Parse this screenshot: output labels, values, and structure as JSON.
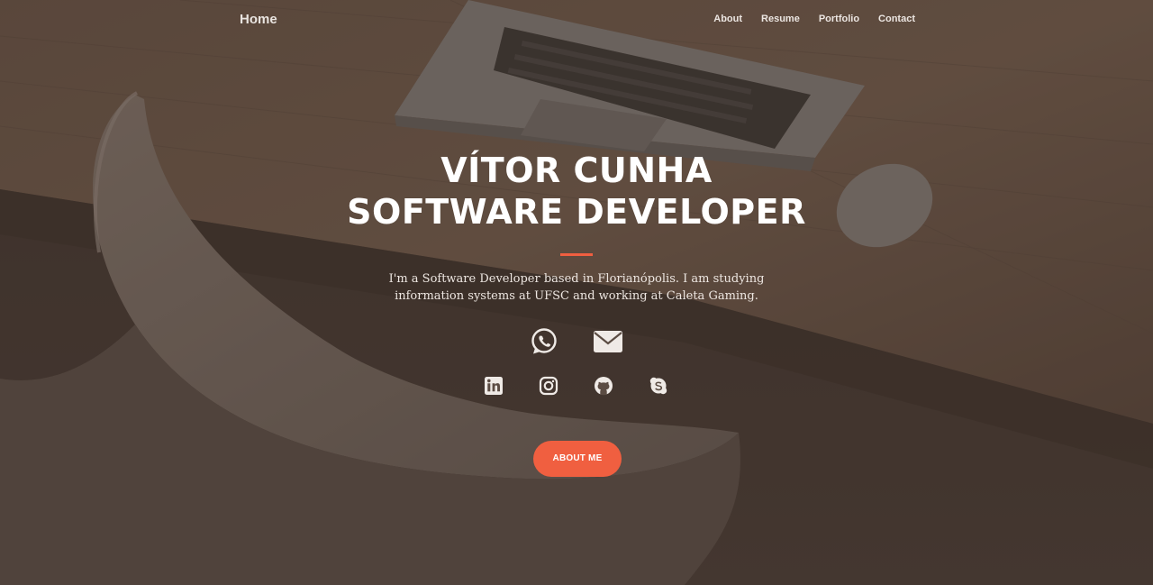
{
  "nav": {
    "brand": "Home",
    "links": [
      "About",
      "Resume",
      "Portfolio",
      "Contact"
    ]
  },
  "hero": {
    "title_line1": "VÍTOR CUNHA",
    "title_line2": "SOFTWARE DEVELOPER",
    "intro": "I'm a Software Developer based in Florianópolis. I am studying information systems at UFSC and working at Caleta Gaming.",
    "cta_label": "ABOUT ME"
  },
  "icons": {
    "contact": [
      "whatsapp-icon",
      "email-icon"
    ],
    "social": [
      "linkedin-icon",
      "instagram-icon",
      "github-icon",
      "skype-icon"
    ]
  },
  "colors": {
    "accent": "#f05f40",
    "text": "#ffffff",
    "overlay": "#3c2d26"
  }
}
